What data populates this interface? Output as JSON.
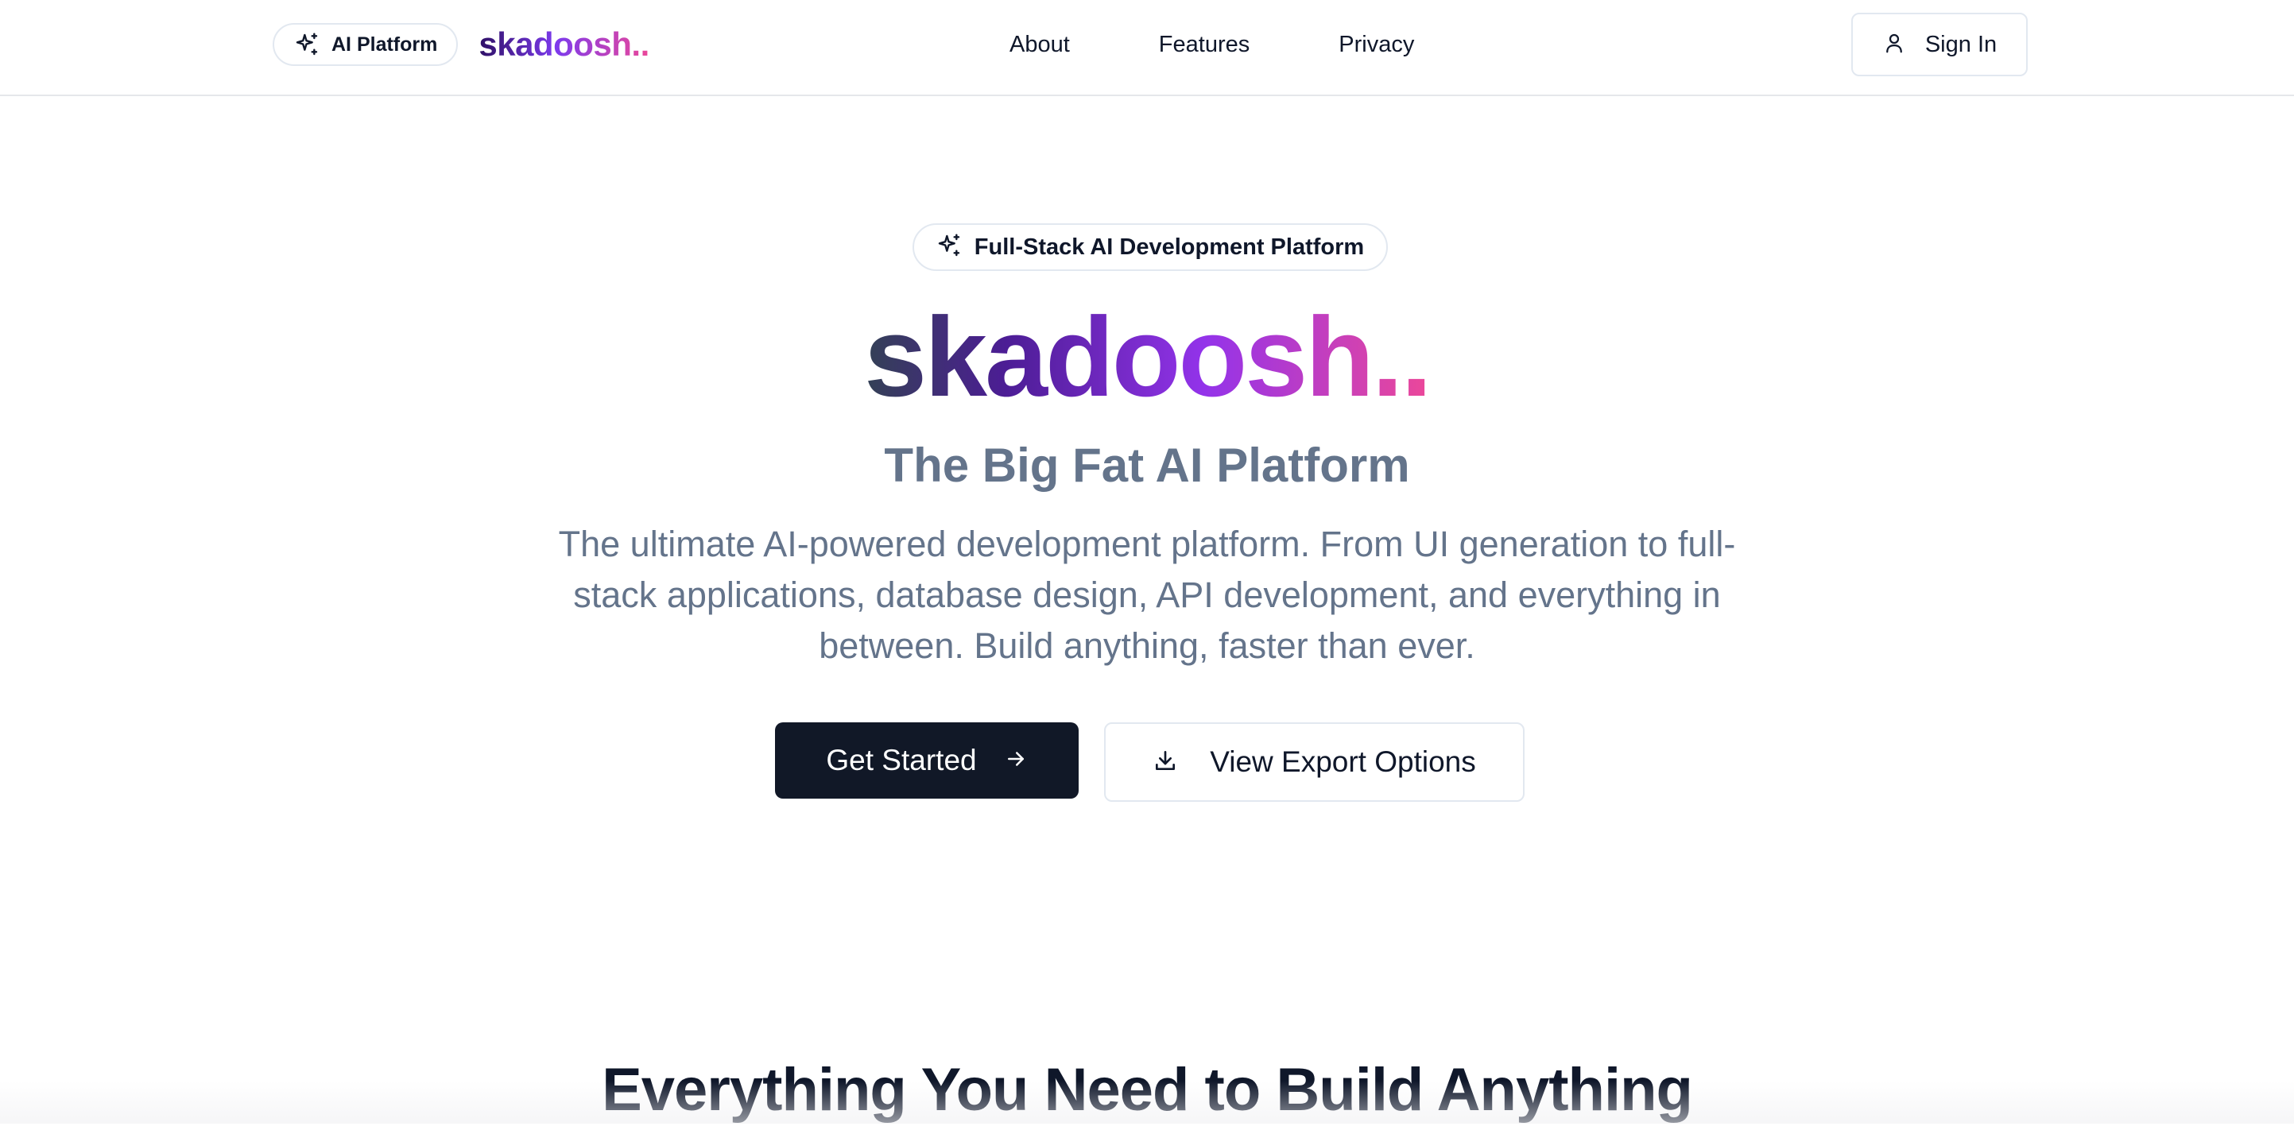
{
  "header": {
    "badge_label": "AI Platform",
    "badge_icon": "sparkles-icon",
    "brand": "skadoosh..",
    "nav": [
      {
        "label": "About"
      },
      {
        "label": "Features"
      },
      {
        "label": "Privacy"
      }
    ],
    "signin_label": "Sign In",
    "signin_icon": "user-icon"
  },
  "hero": {
    "pill_label": "Full-Stack AI Development Platform",
    "pill_icon": "sparkles-icon",
    "title": "skadoosh..",
    "subtitle": "The Big Fat AI Platform",
    "description": "The ultimate AI-powered development platform. From UI generation to full-stack applications, database design, API development, and everything in between. Build anything, faster than ever.",
    "primary_button": "Get Started",
    "primary_icon": "arrow-right-icon",
    "secondary_button": "View Export Options",
    "secondary_icon": "download-icon"
  },
  "features": {
    "heading": "Everything You Need to Build Anything"
  },
  "colors": {
    "primary_button_bg": "#111827",
    "muted_text": "#64748b",
    "brand_gradient_start": "#2e1065",
    "brand_gradient_mid": "#9333ea",
    "brand_gradient_end": "#ec4899"
  }
}
